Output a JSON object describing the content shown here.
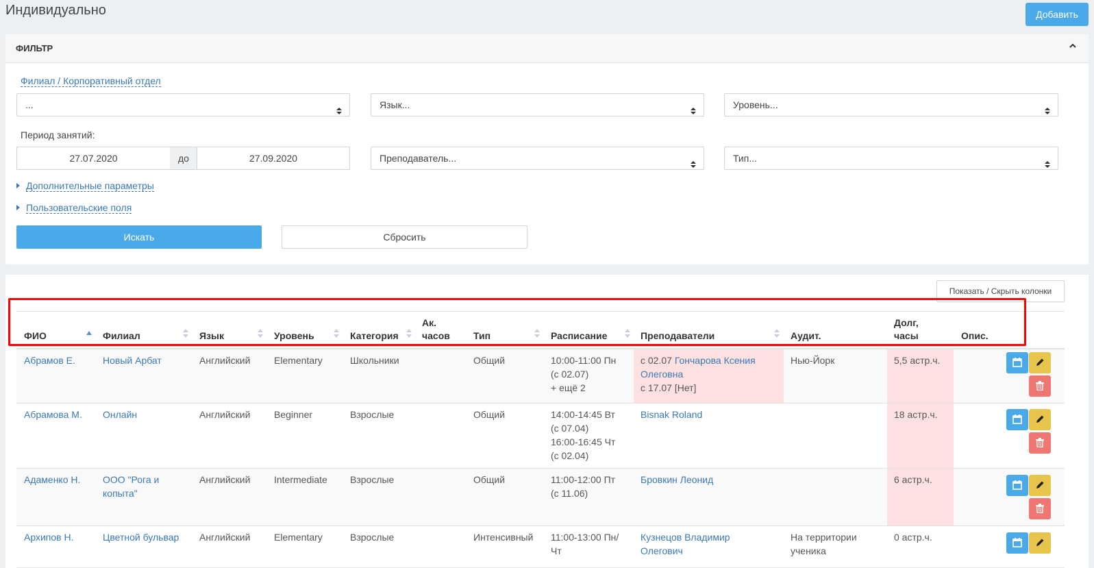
{
  "page": {
    "title": "Индивидуально",
    "add_button": "Добавить"
  },
  "filter": {
    "title": "ФИЛЬТР",
    "branch_label": "Филиал / Корпоративный отдел",
    "branch_value": "...",
    "language_placeholder": "Язык...",
    "level_placeholder": "Уровень...",
    "period_label": "Период занятий:",
    "date_from": "27.07.2020",
    "date_to_label": "до",
    "date_to": "27.09.2020",
    "teacher_placeholder": "Преподаватель...",
    "type_placeholder": "Тип...",
    "extra_params": "Дополнительные параметры",
    "custom_fields": "Пользовательские поля",
    "search_button": "Искать",
    "reset_button": "Сбросить"
  },
  "table": {
    "columns_button": "Показать / Скрыть колонки",
    "headers": {
      "name": "ФИО",
      "branch": "Филиал",
      "language": "Язык",
      "level": "Уровень",
      "category": "Категория",
      "hours_1": "Ак.",
      "hours_2": "часов",
      "type": "Тип",
      "schedule": "Расписание",
      "teachers": "Преподаватели",
      "room": "Аудит.",
      "debt_1": "Долг,",
      "debt_2": "часы",
      "desc": "Опис."
    },
    "rows": [
      {
        "name": "Абрамов Е.",
        "branch": "Новый Арбат",
        "language": "Английский",
        "level": "Elementary",
        "category": "Школьники",
        "type": "Общий",
        "schedule": [
          "10:00-11:00 Пн",
          "(с 02.07)",
          "+ ещё 2"
        ],
        "teacher_prefix": "с 02.07 ",
        "teacher_name": "Гончарова Ксения Олеговна",
        "teacher_line3": "с 17.07 [Нет]",
        "room": "Нью-Йорк",
        "debt": "5,5 астр.ч."
      },
      {
        "name": "Абрамова М.",
        "branch": "Онлайн",
        "language": "Английский",
        "level": "Beginner",
        "category": "Взрослые",
        "type": "Общий",
        "schedule": [
          "14:00-14:45 Вт",
          "(с 07.04)",
          "16:00-16:45 Чт",
          "(с 02.04)"
        ],
        "teacher": "Bisnak Roland",
        "room": "",
        "debt": "18 астр.ч."
      },
      {
        "name": "Адаменко Н.",
        "branch": "ООО \"Рога и копыта\"",
        "language": "Английский",
        "level": "Intermediate",
        "category": "Взрослые",
        "type": "Общий",
        "schedule": [
          "11:00-12:00 Пт",
          "(с 11.06)"
        ],
        "teacher": "Бровкин Леонид",
        "room": "",
        "debt": "6 астр.ч."
      },
      {
        "name": "Архипов Н.",
        "branch": "Цветной бульвар",
        "language": "Английский",
        "level": "Elementary",
        "category": "Взрослые",
        "type": "Интенсивный",
        "schedule": [
          "11:00-13:00 Пн/",
          "Чт"
        ],
        "teacher": "Кузнецов Владимир Олегович",
        "room": "На территории ученика",
        "debt": "0 астр.ч."
      }
    ]
  }
}
